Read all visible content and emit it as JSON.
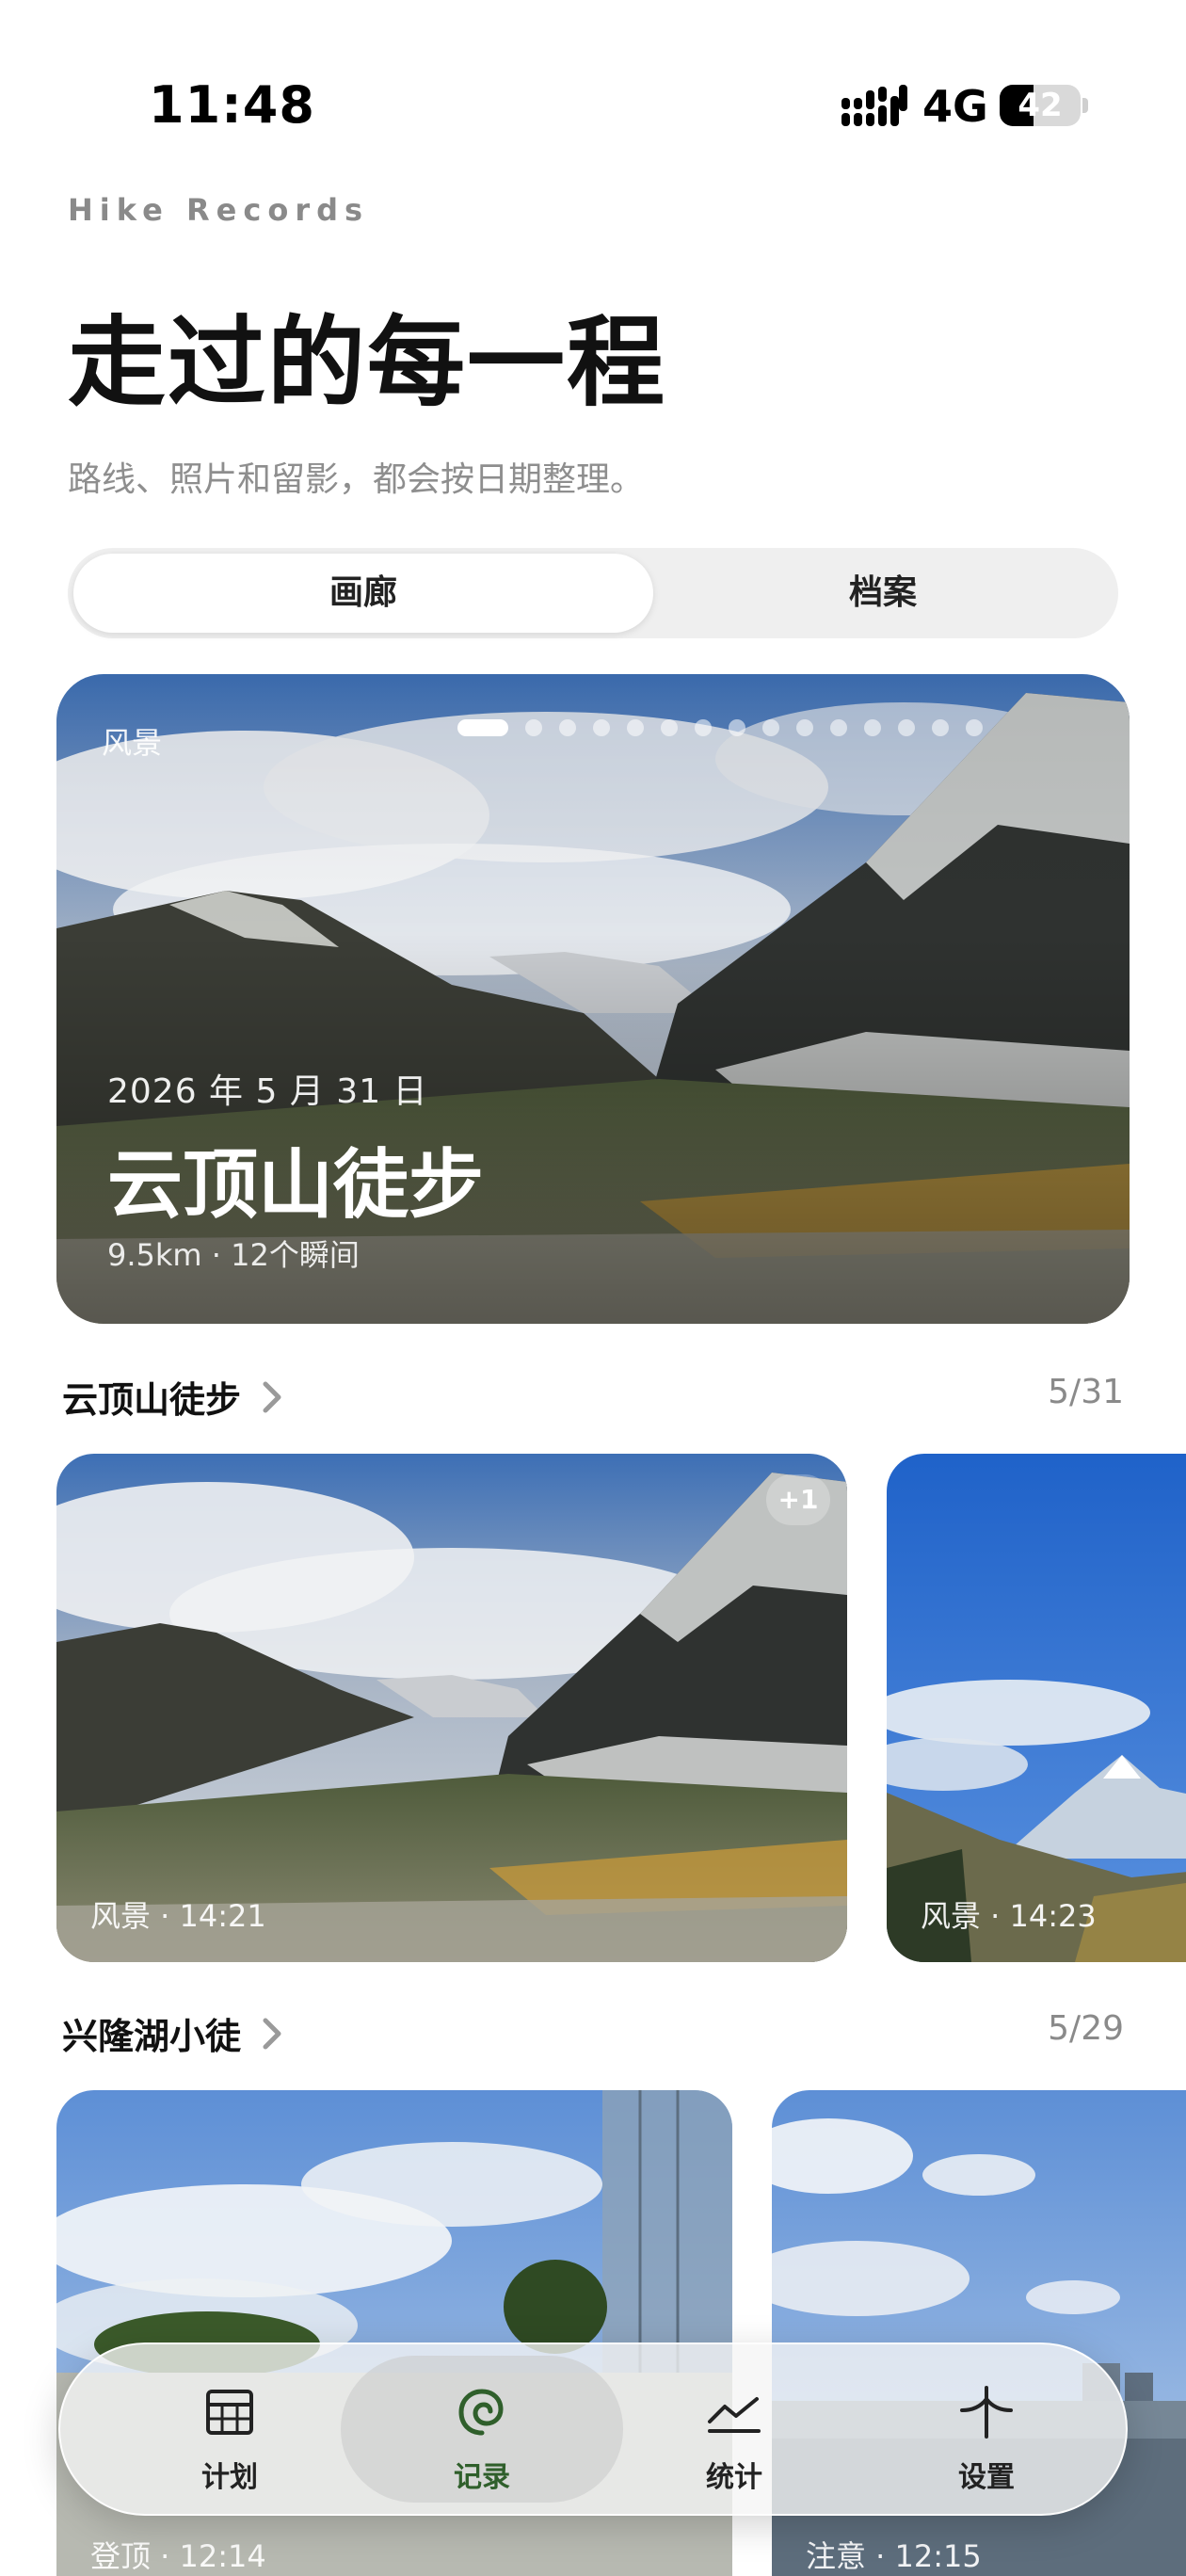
{
  "status_bar": {
    "time": "11:48",
    "network": "4G",
    "battery": "42",
    "battery_level_percent": 42
  },
  "header": {
    "eyebrow": "Hike Records",
    "title": "走过的每一程",
    "subtitle": "路线、照片和留影，都会按日期整理。"
  },
  "segmented": {
    "tabs": [
      {
        "label": "画廊",
        "active": true
      },
      {
        "label": "档案",
        "active": false
      }
    ]
  },
  "hero": {
    "tag": "风景",
    "date": "2026 年 5 月 31 日",
    "title": "云顶山徒步",
    "meta": "9.5km · 12个瞬间",
    "page_count": 15,
    "current_page": 1
  },
  "sections": [
    {
      "title": "云顶山徒步",
      "date": "5/31",
      "cards": [
        {
          "caption": "风景 · 14:21",
          "badge": "+1"
        },
        {
          "caption": "风景 · 14:23",
          "badge": ""
        }
      ]
    },
    {
      "title": "兴隆湖小徒",
      "date": "5/29",
      "cards": [
        {
          "caption": "登顶 · 12:14",
          "badge": ""
        },
        {
          "caption": "注意 · 12:15",
          "badge": ""
        }
      ]
    }
  ],
  "tab_bar": {
    "items": [
      {
        "label": "计划",
        "icon": "calendar-icon",
        "active": false
      },
      {
        "label": "记录",
        "icon": "record-swirl-icon",
        "active": true
      },
      {
        "label": "统计",
        "icon": "chart-line-icon",
        "active": false
      },
      {
        "label": "设置",
        "icon": "sparkle-icon",
        "active": false
      }
    ]
  },
  "colors": {
    "accent_active_tab": "#2f5f2b",
    "secondary_text": "#8a8a8a",
    "segmented_bg": "#efefef"
  }
}
